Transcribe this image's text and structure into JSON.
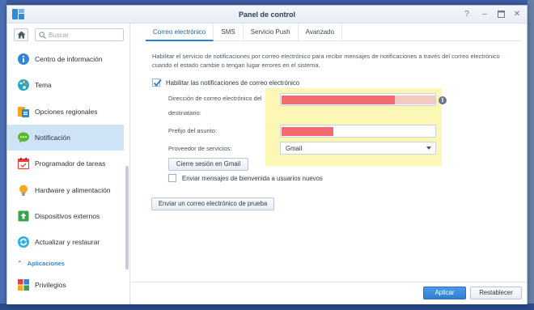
{
  "window": {
    "title": "Panel de control"
  },
  "sidebar": {
    "search_placeholder": "Buscar",
    "items": [
      {
        "label": "Centro de información",
        "icon": "info-icon",
        "active": false
      },
      {
        "label": "Tema",
        "icon": "palette-icon",
        "active": false
      },
      {
        "label": "Opciones regionales",
        "icon": "regional-options-icon",
        "active": false
      },
      {
        "label": "Notificación",
        "icon": "chat-bubble-icon",
        "active": true
      },
      {
        "label": "Programador de tareas",
        "icon": "calendar-icon",
        "active": false
      },
      {
        "label": "Hardware y alimentación",
        "icon": "lightbulb-icon",
        "active": false
      },
      {
        "label": "Dispositivos externos",
        "icon": "upload-device-icon",
        "active": false
      },
      {
        "label": "Actualizar y restaurar",
        "icon": "refresh-icon",
        "active": false
      }
    ],
    "section": {
      "label": "Aplicaciones"
    },
    "after_section": [
      {
        "label": "Privilegios",
        "icon": "privileges-grid-icon",
        "active": false
      }
    ]
  },
  "tabs": [
    {
      "label": "Correo electrónico",
      "active": true
    },
    {
      "label": "SMS",
      "active": false
    },
    {
      "label": "Servicio Push",
      "active": false
    },
    {
      "label": "Avanzado",
      "active": false
    }
  ],
  "email": {
    "description": "Habilitar el servicio de notificaciones por correo electrónico para recibir mensajes de notificaciones a través del correo electrónico cuando el estado cambie o tengan lugar errores en el sistema.",
    "enable_label": "Habilitar las notificaciones de correo electrónico",
    "enable_checked": true,
    "recipient_label_line1": "Dirección de correo electrónico del",
    "recipient_label_line2": "destinatario:",
    "subject_label": "Prefijo del asunto:",
    "provider_label": "Proveedor de servicios:",
    "provider_value": "Gmail",
    "signout_button": "Cierre sesión en Gmail",
    "welcome_label": "Enviar mensajes de bienvenida a usuarios nuevos",
    "welcome_checked": false,
    "test_button": "Enviar un correo electrónico de prueba"
  },
  "footer": {
    "apply_button": "Aplicar",
    "reset_button": "Restablecer"
  },
  "colors": {
    "accent": "#2f7fd0",
    "highlight": "#fdf7b5",
    "active_nav": "#cfe3f7",
    "redaction": "#f36b6f"
  }
}
